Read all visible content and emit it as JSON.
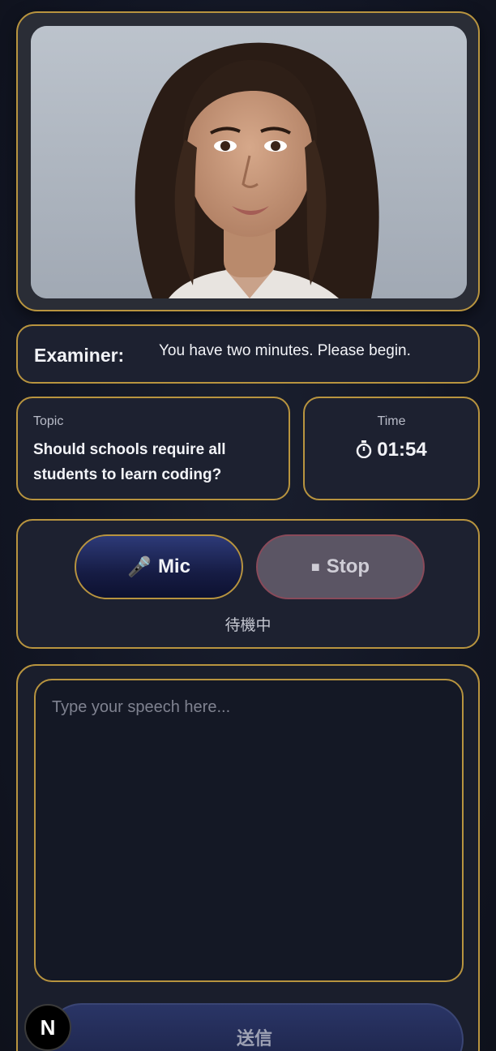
{
  "examiner": {
    "label": "Examiner:",
    "message": "You have two minutes. Please begin."
  },
  "topic": {
    "label": "Topic",
    "text": "Should schools require all students to learn coding?"
  },
  "timer": {
    "label": "Time",
    "value": "01:54",
    "icon": "stopwatch-icon"
  },
  "controls": {
    "mic_label": "Mic",
    "mic_icon": "🎤",
    "stop_label": "Stop",
    "stop_icon": "■",
    "status": "待機中"
  },
  "speech_input": {
    "placeholder": "Type your speech here...",
    "value": ""
  },
  "send": {
    "label": "送信"
  },
  "badge": {
    "letter": "N"
  },
  "colors": {
    "accent_gold": "#b8943f",
    "background": "#121624",
    "card": "#1d2130",
    "mic_button": "#1b2352",
    "stop_button": "#5b5564"
  }
}
